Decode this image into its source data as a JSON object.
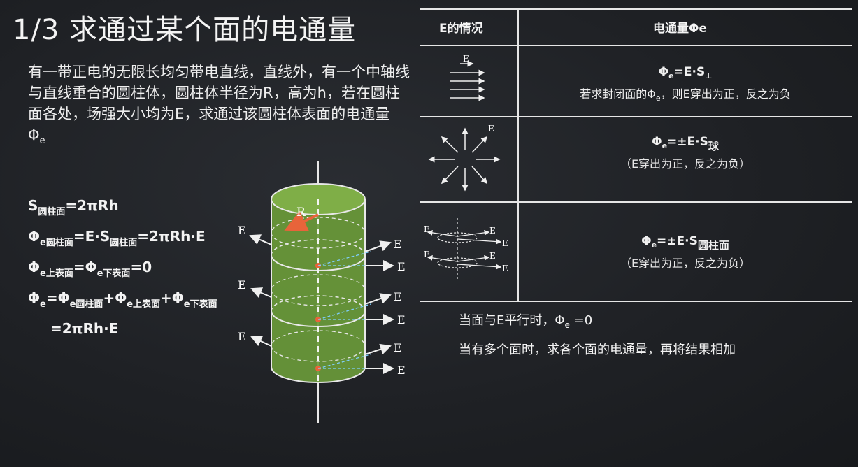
{
  "slide": {
    "title": "1/3  求通过某个面的电通量",
    "problem_text": "有一带正电的无限长均匀带电直线，直线外，有一个中轴线与直线重合的圆柱体，圆柱体半径为R，高为h，若在圆柱面各处，场强大小均为E，求通过该圆柱体表面的电通量 Φ",
    "problem_sub": "e"
  },
  "formulas": [
    {
      "parts": [
        "S",
        "圆柱面",
        "=2πRh"
      ]
    },
    {
      "parts": [
        "Φ",
        "e圆柱面",
        "=E·S",
        "圆柱面",
        "=2πRh·E"
      ]
    },
    {
      "parts": [
        "Φ",
        "e上表面",
        "=Φ",
        "e下表面",
        "=0"
      ]
    },
    {
      "parts": [
        "Φ",
        "e",
        "=Φ",
        "e圆柱面",
        "+Φ",
        "e上表面",
        "+Φ",
        "e下表面"
      ]
    },
    {
      "parts": [
        "=2πRh·E"
      ]
    }
  ],
  "diagram": {
    "radius_label": "R",
    "field_label": "E"
  },
  "table": {
    "header_left": "E的情况",
    "header_right": "电通量Φe",
    "rows": [
      {
        "icon": "parallel-field-icon",
        "icon_label": "E",
        "line1_a": "Φ",
        "line1_sub": "e",
        "line1_b": "=E·S",
        "line1_sub2": "⊥",
        "line2_a": "若求封闭面的Φ",
        "line2_sub": "e",
        "line2_b": "，则E穿出为正，反之为负"
      },
      {
        "icon": "radial-field-icon",
        "icon_label": "E",
        "line1_a": "Φ",
        "line1_sub": "e",
        "line1_b": "=±E·S",
        "line1_sub2": "球",
        "line2": "（E穿出为正，反之为负）"
      },
      {
        "icon": "cylindrical-field-icon",
        "icon_label": "E",
        "line1_a": "Φ",
        "line1_sub": "e",
        "line1_b": "=±E·S",
        "line1_sub2": "圆柱面",
        "line2": "（E穿出为正，反之为负）"
      }
    ]
  },
  "notes": [
    {
      "a": "当面与E平行时，Φ",
      "sub": "e",
      "b": " =0"
    },
    {
      "text": "当有多个面时，求各个面的电通量，再将结果相加"
    }
  ],
  "colors": {
    "board": "#1f2125",
    "chalk": "#f1f1f1",
    "cylinder": "#6a9a3a",
    "radius_arrow": "#e8643a"
  }
}
